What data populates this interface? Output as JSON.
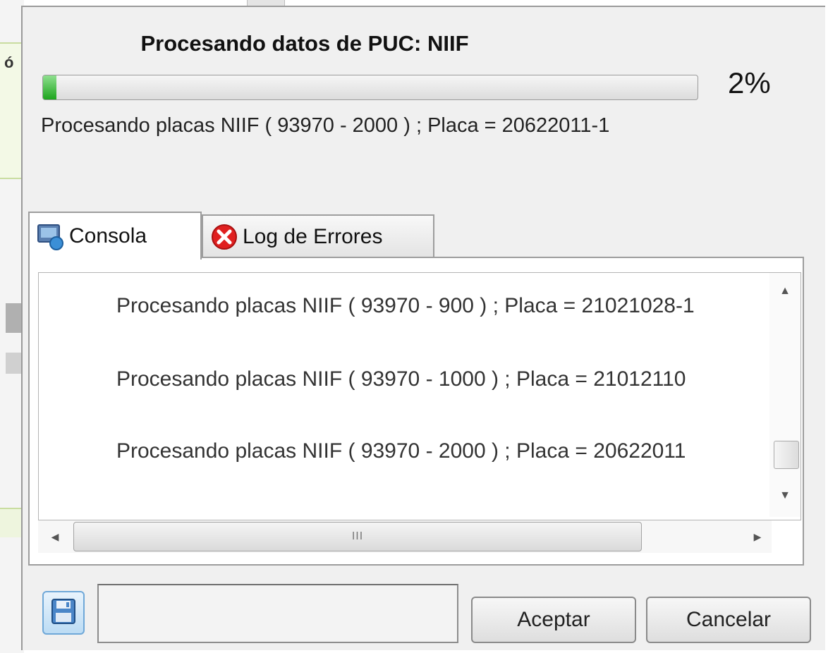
{
  "window": {
    "title": "Procesando datos de PUC: NIIF",
    "progress_percent_label": "2%",
    "progress_fraction": 0.02,
    "status_text": "Procesando placas NIIF ( 93970 - 2000 ) ; Placa = 20622011-1"
  },
  "background": {
    "partial_label": "ó"
  },
  "tabs": [
    {
      "label": "Consola",
      "icon": "console-icon",
      "active": true
    },
    {
      "label": "Log de Errores",
      "icon": "error-icon",
      "active": false
    }
  ],
  "console": {
    "lines": [
      "Procesando placas NIIF ( 93970 - 900 ) ; Placa = 21021028-1",
      "Procesando placas NIIF ( 93970 - 1000 ) ; Placa = 21012110",
      "Procesando placas NIIF ( 93970 - 2000 ) ; Placa = 20622011"
    ],
    "hscroll_grip": "III"
  },
  "footer": {
    "input_value": "",
    "accept_label": "Aceptar",
    "cancel_label": "Cancelar",
    "save_icon": "floppy-disk-icon"
  },
  "colors": {
    "progress_fill": "#1da51d",
    "error_icon": "#e02020",
    "save_button_border": "#6fa8d8"
  }
}
